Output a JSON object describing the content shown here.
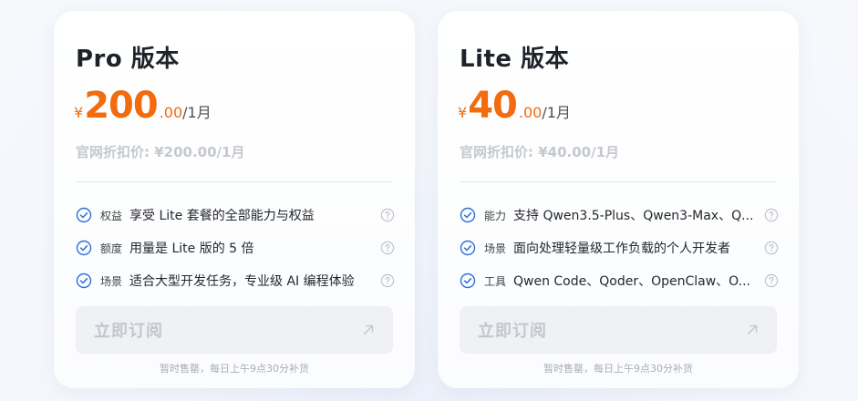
{
  "cards": [
    {
      "title": "Pro 版本",
      "currency": "¥",
      "amount": "200",
      "decimals": ".00",
      "period": "/1月",
      "official_price": "官网折扣价: ¥200.00/1月",
      "features": [
        {
          "tag": "权益",
          "text": "享受 Lite 套餐的全部能力与权益"
        },
        {
          "tag": "额度",
          "text": "用量是 Lite 版的 5 倍"
        },
        {
          "tag": "场景",
          "text": "适合大型开发任务，专业级 AI 编程体验"
        }
      ],
      "subscribe_label": "立即订阅",
      "sold_out": "暂时售罄，每日上午9点30分补货"
    },
    {
      "title": "Lite 版本",
      "currency": "¥",
      "amount": "40",
      "decimals": ".00",
      "period": "/1月",
      "official_price": "官网折扣价: ¥40.00/1月",
      "features": [
        {
          "tag": "能力",
          "text": "支持 Qwen3.5-Plus、Qwen3-Max、Q..."
        },
        {
          "tag": "场景",
          "text": "面向处理轻量级工作负载的个人开发者"
        },
        {
          "tag": "工具",
          "text": "Qwen Code、Qoder、OpenClaw、O..."
        }
      ],
      "subscribe_label": "立即订阅",
      "sold_out": "暂时售罄，每日上午9点30分补货"
    }
  ],
  "icons": {
    "feature": "check-circle-icon",
    "help": "question-circle-icon",
    "subscribe": "arrow-up-right-icon"
  },
  "colors": {
    "accent": "#f26b0f",
    "check": "#2a6fd6",
    "disabled_text": "#c3c7ce"
  }
}
